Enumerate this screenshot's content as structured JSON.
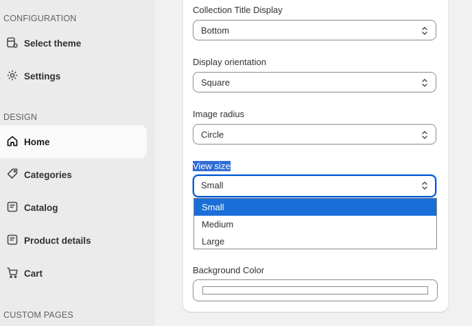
{
  "sidebar": {
    "configuration_label": "CONFIGURATION",
    "design_label": "DESIGN",
    "custom_pages_label": "CUSTOM PAGES",
    "items": [
      {
        "label": "Select theme",
        "icon": "theme-icon"
      },
      {
        "label": "Settings",
        "icon": "gear-icon"
      },
      {
        "label": "Home",
        "icon": "home-icon",
        "active": true
      },
      {
        "label": "Categories",
        "icon": "tag-icon"
      },
      {
        "label": "Catalog",
        "icon": "catalog-icon"
      },
      {
        "label": "Product details",
        "icon": "product-details-icon"
      },
      {
        "label": "Cart",
        "icon": "cart-icon"
      }
    ]
  },
  "form": {
    "collection_title_display": {
      "label": "Collection Title Display",
      "value": "Bottom"
    },
    "display_orientation": {
      "label": "Display orientation",
      "value": "Square"
    },
    "image_radius": {
      "label": "Image radius",
      "value": "Circle"
    },
    "view_size": {
      "label": "View size",
      "value": "Small",
      "options": [
        "Small",
        "Medium",
        "Large"
      ]
    },
    "background_color": {
      "label": "Background Color",
      "value": "#ffffff"
    }
  },
  "colors": {
    "accent": "#005bd3",
    "selected_option": "#1a6ed8",
    "highlight": "#2f6cd6"
  }
}
